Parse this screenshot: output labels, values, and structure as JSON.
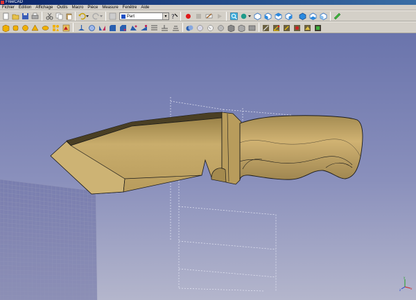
{
  "app": {
    "title": "FreeCAD"
  },
  "menu": [
    {
      "label": "Fichier"
    },
    {
      "label": "Édition"
    },
    {
      "label": "Affichage"
    },
    {
      "label": "Outils"
    },
    {
      "label": "Macro"
    },
    {
      "label": "Pièce"
    },
    {
      "label": "Measure"
    },
    {
      "label": "Fenêtre"
    },
    {
      "label": "Aide"
    }
  ],
  "workbench": {
    "selected": "Part"
  },
  "colors": {
    "knife": "#c8ab6a",
    "knife_dark": "#8f7840",
    "edge": "#1a1a1a",
    "grid": "#8e90a6",
    "sketch": "#e8e8f4",
    "background_top": "#6a74ac",
    "background_bottom": "#b4b6cc"
  },
  "toolbar_icons": [
    "new-icon",
    "open-icon",
    "save-icon",
    "print-icon",
    "cut-icon",
    "copy-icon",
    "paste-icon",
    "undo-icon",
    "redo-icon",
    "refresh-icon",
    "whatsthis-icon",
    "macro-record-icon",
    "macro-stop-icon",
    "macro-edit-icon",
    "macro-run-icon",
    "fit-all-icon",
    "draw-style-icon",
    "view-isometric-icon",
    "view-front-icon",
    "view-top-icon",
    "view-right-icon",
    "view-rear-icon",
    "view-bottom-icon",
    "view-left-icon",
    "measure-icon"
  ]
}
